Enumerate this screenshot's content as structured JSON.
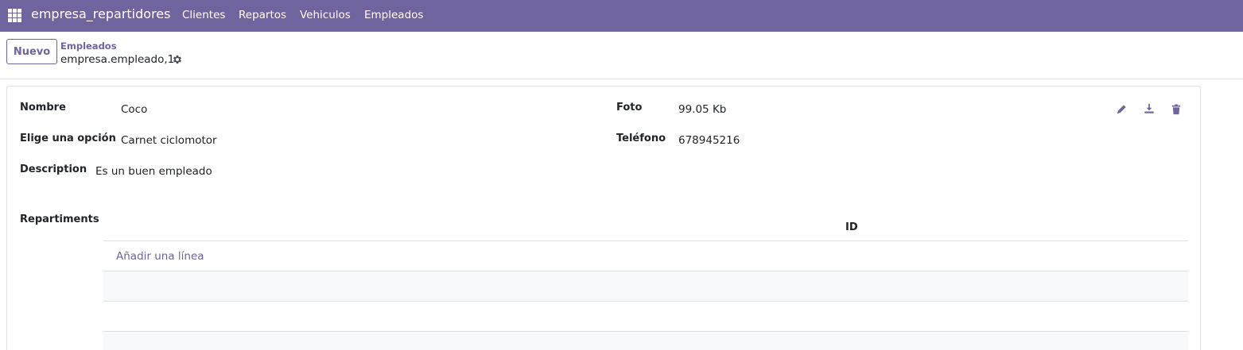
{
  "navbar": {
    "brand": "empresa_repartidores",
    "menu": [
      "Clientes",
      "Repartos",
      "Vehiculos",
      "Empleados"
    ]
  },
  "control_panel": {
    "new_button": "Nuevo",
    "breadcrumb": "Empleados",
    "record_name": "empresa.empleado,1"
  },
  "form": {
    "fields": {
      "nombre": {
        "label": "Nombre",
        "value": "Coco"
      },
      "opcion": {
        "label": "Elige una opción",
        "value": "Carnet ciclomotor"
      },
      "description": {
        "label": "Description",
        "value": "Es un buen empleado"
      },
      "foto": {
        "label": "Foto",
        "value": "99.05 Kb"
      },
      "telefono": {
        "label": "Teléfono",
        "value": "678945216"
      }
    },
    "repartiments": {
      "label": "Repartiments",
      "column_header": "ID",
      "add_line": "Añadir una línea"
    }
  },
  "colors": {
    "brand": "#71639e",
    "border": "#dee2e6"
  }
}
